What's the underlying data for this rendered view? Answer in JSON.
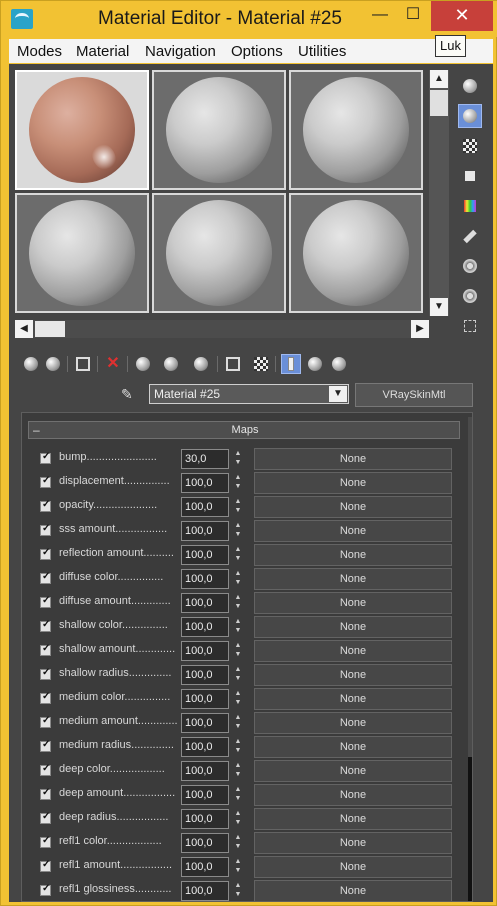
{
  "window": {
    "title": "Material Editor - Material #25",
    "minimize_glyph": "—",
    "maximize_glyph": "☐",
    "close_glyph": "✕",
    "tooltip": "Luk"
  },
  "menu": [
    "Modes",
    "Material",
    "Navigation",
    "Options",
    "Utilities"
  ],
  "slots": [
    {
      "material": "skin",
      "active": true
    },
    {
      "material": "grey",
      "active": false
    },
    {
      "material": "grey",
      "active": false
    },
    {
      "material": "grey",
      "active": false
    },
    {
      "material": "grey",
      "active": false
    },
    {
      "material": "grey",
      "active": false
    }
  ],
  "side_tools": [
    "sample-type-icon",
    "backlight-icon",
    "background-checker-icon",
    "sample-uv-tiling-icon",
    "video-color-check-icon",
    "make-preview-icon",
    "options-icon",
    "select-by-material-icon",
    "material-map-navigator-icon"
  ],
  "toolbar": [
    "get-material-icon",
    "put-to-scene-icon",
    "assign-to-selection-icon",
    "reset-map-icon",
    "make-unique-icon",
    "put-to-library-icon",
    "material-id-channel-icon",
    "show-shaded-in-viewport-icon",
    "show-end-result-icon",
    "go-to-parent-icon",
    "go-forward-to-sibling-icon"
  ],
  "material": {
    "name": "Material #25",
    "type": "VRaySkinMtl"
  },
  "maps": {
    "title": "Maps",
    "collapse_glyph": "–",
    "rows": [
      {
        "label": "bump.......................",
        "value": "30,0",
        "map": "None"
      },
      {
        "label": "displacement...............",
        "value": "100,0",
        "map": "None"
      },
      {
        "label": "opacity.....................",
        "value": "100,0",
        "map": "None"
      },
      {
        "label": "sss amount.................",
        "value": "100,0",
        "map": "None"
      },
      {
        "label": "reflection amount..........",
        "value": "100,0",
        "map": "None"
      },
      {
        "label": "diffuse color...............",
        "value": "100,0",
        "map": "None"
      },
      {
        "label": "diffuse amount.............",
        "value": "100,0",
        "map": "None"
      },
      {
        "label": "shallow color...............",
        "value": "100,0",
        "map": "None"
      },
      {
        "label": "shallow amount.............",
        "value": "100,0",
        "map": "None"
      },
      {
        "label": "shallow radius..............",
        "value": "100,0",
        "map": "None"
      },
      {
        "label": "medium color...............",
        "value": "100,0",
        "map": "None"
      },
      {
        "label": "medium amount.............",
        "value": "100,0",
        "map": "None"
      },
      {
        "label": "medium radius..............",
        "value": "100,0",
        "map": "None"
      },
      {
        "label": "deep color..................",
        "value": "100,0",
        "map": "None"
      },
      {
        "label": "deep amount.................",
        "value": "100,0",
        "map": "None"
      },
      {
        "label": "deep radius.................",
        "value": "100,0",
        "map": "None"
      },
      {
        "label": "refl1 color..................",
        "value": "100,0",
        "map": "None"
      },
      {
        "label": "refl1 amount.................",
        "value": "100,0",
        "map": "None"
      },
      {
        "label": "refl1 glossiness............",
        "value": "100,0",
        "map": "None"
      }
    ]
  }
}
